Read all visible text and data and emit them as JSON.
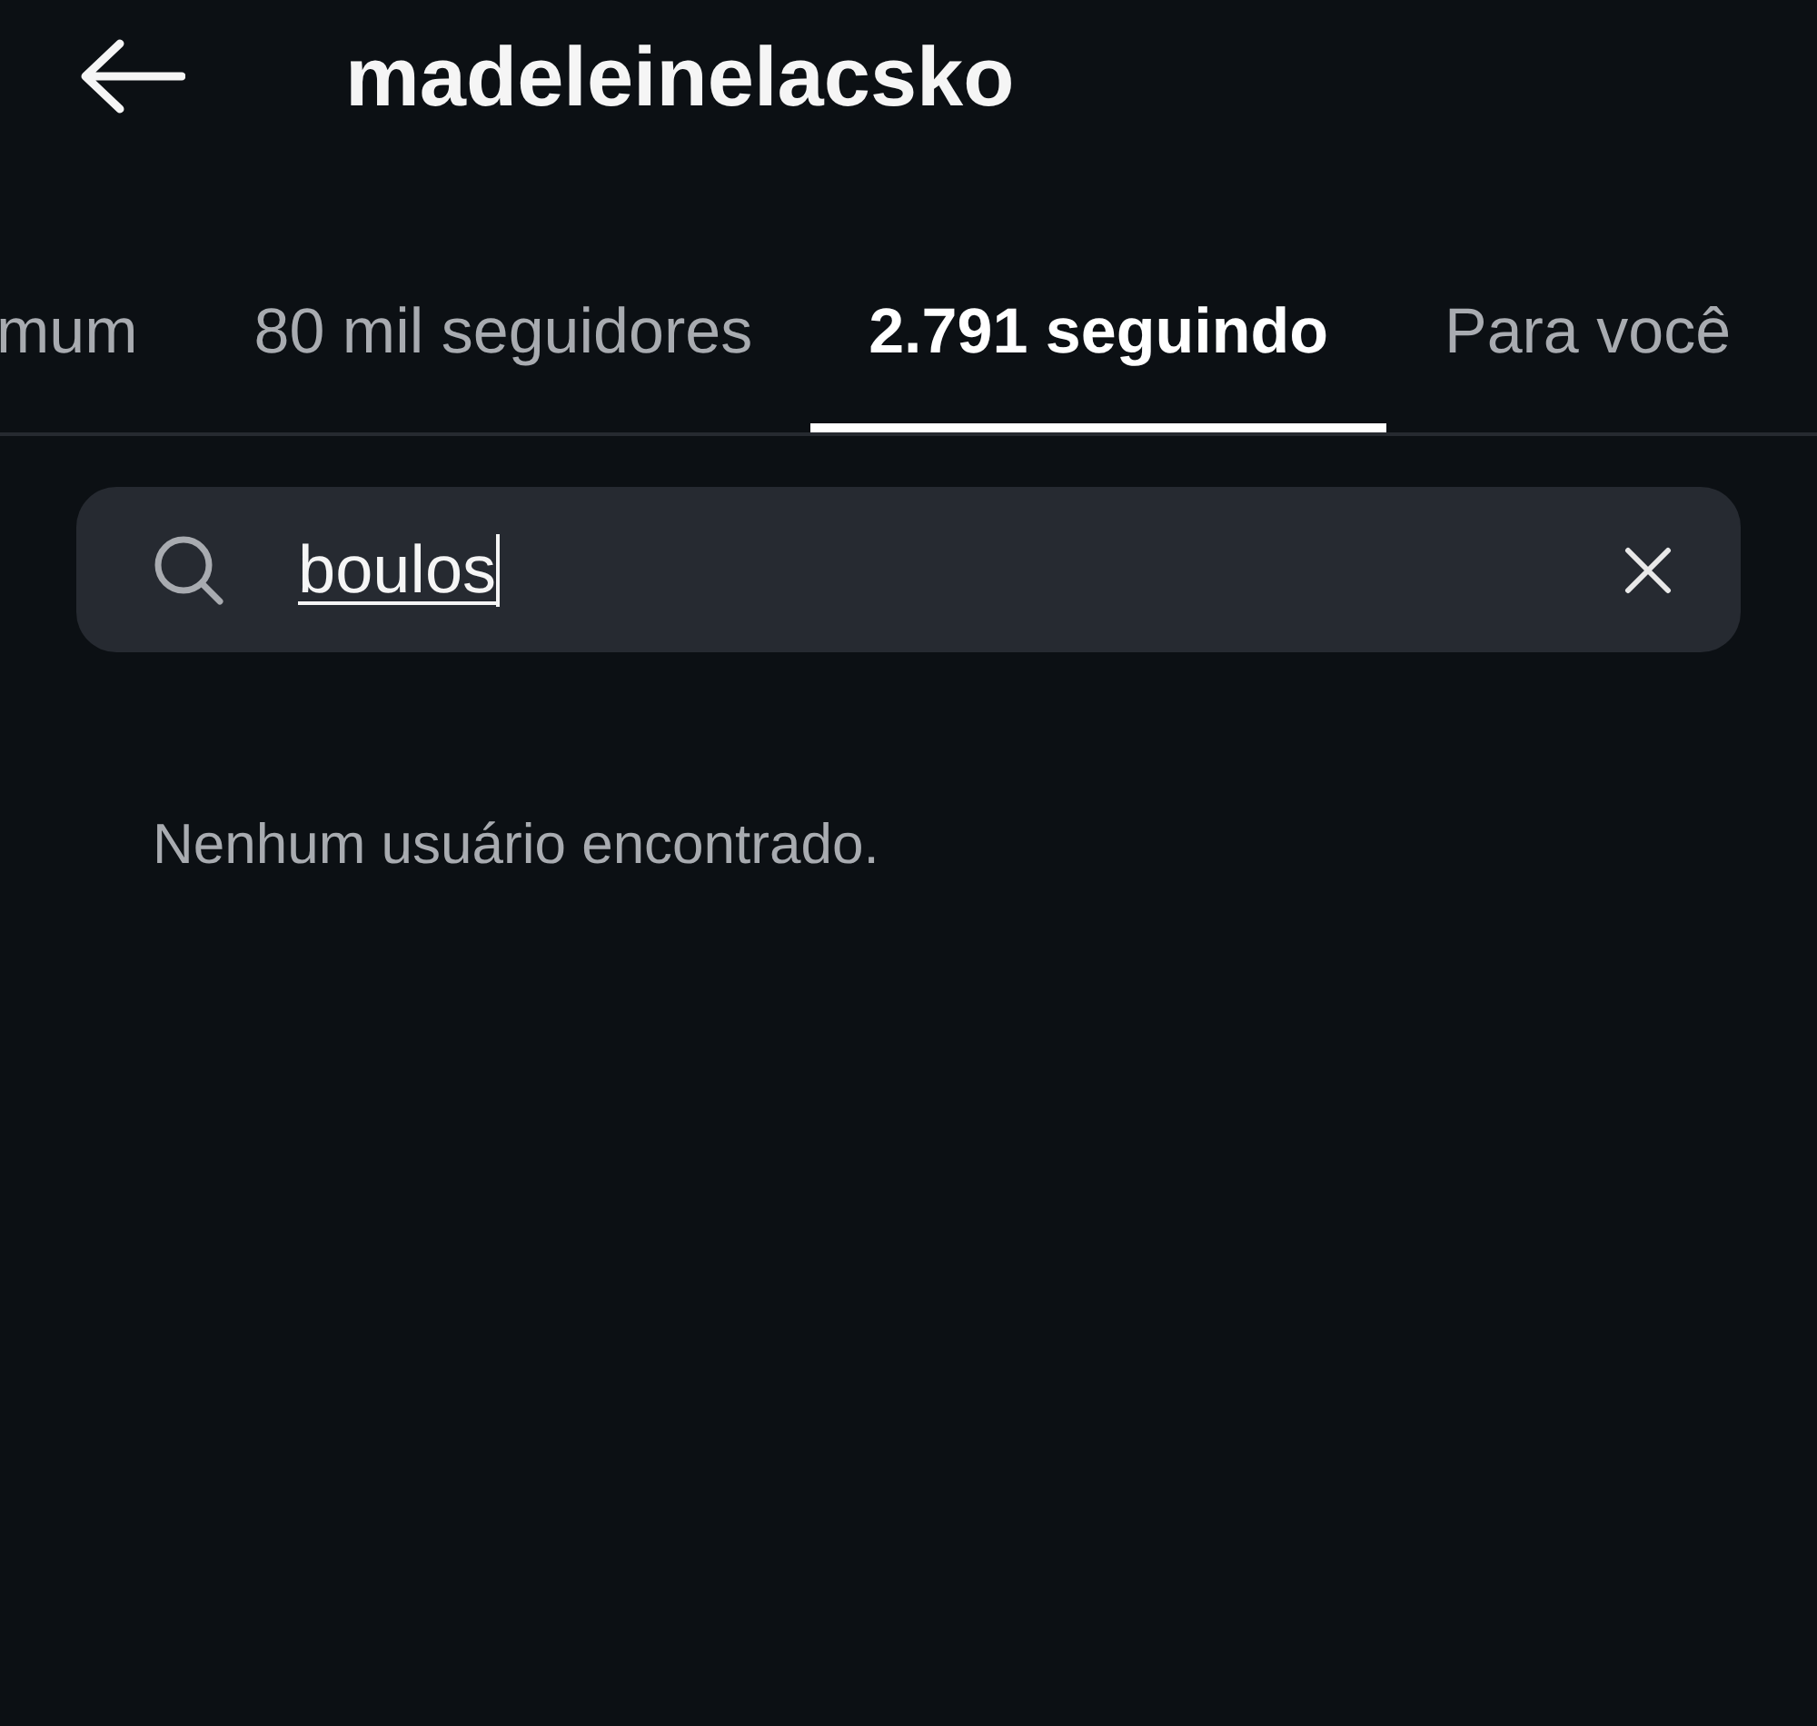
{
  "header": {
    "title": "madeleinelacsko"
  },
  "tabs": [
    {
      "label": "mum",
      "selected": false
    },
    {
      "label": "80 mil seguidores",
      "selected": false
    },
    {
      "label": "2.791 seguindo",
      "selected": true
    },
    {
      "label": "Para você",
      "selected": false
    }
  ],
  "search": {
    "value": "boulos"
  },
  "message": "Nenhum usuário encontrado."
}
